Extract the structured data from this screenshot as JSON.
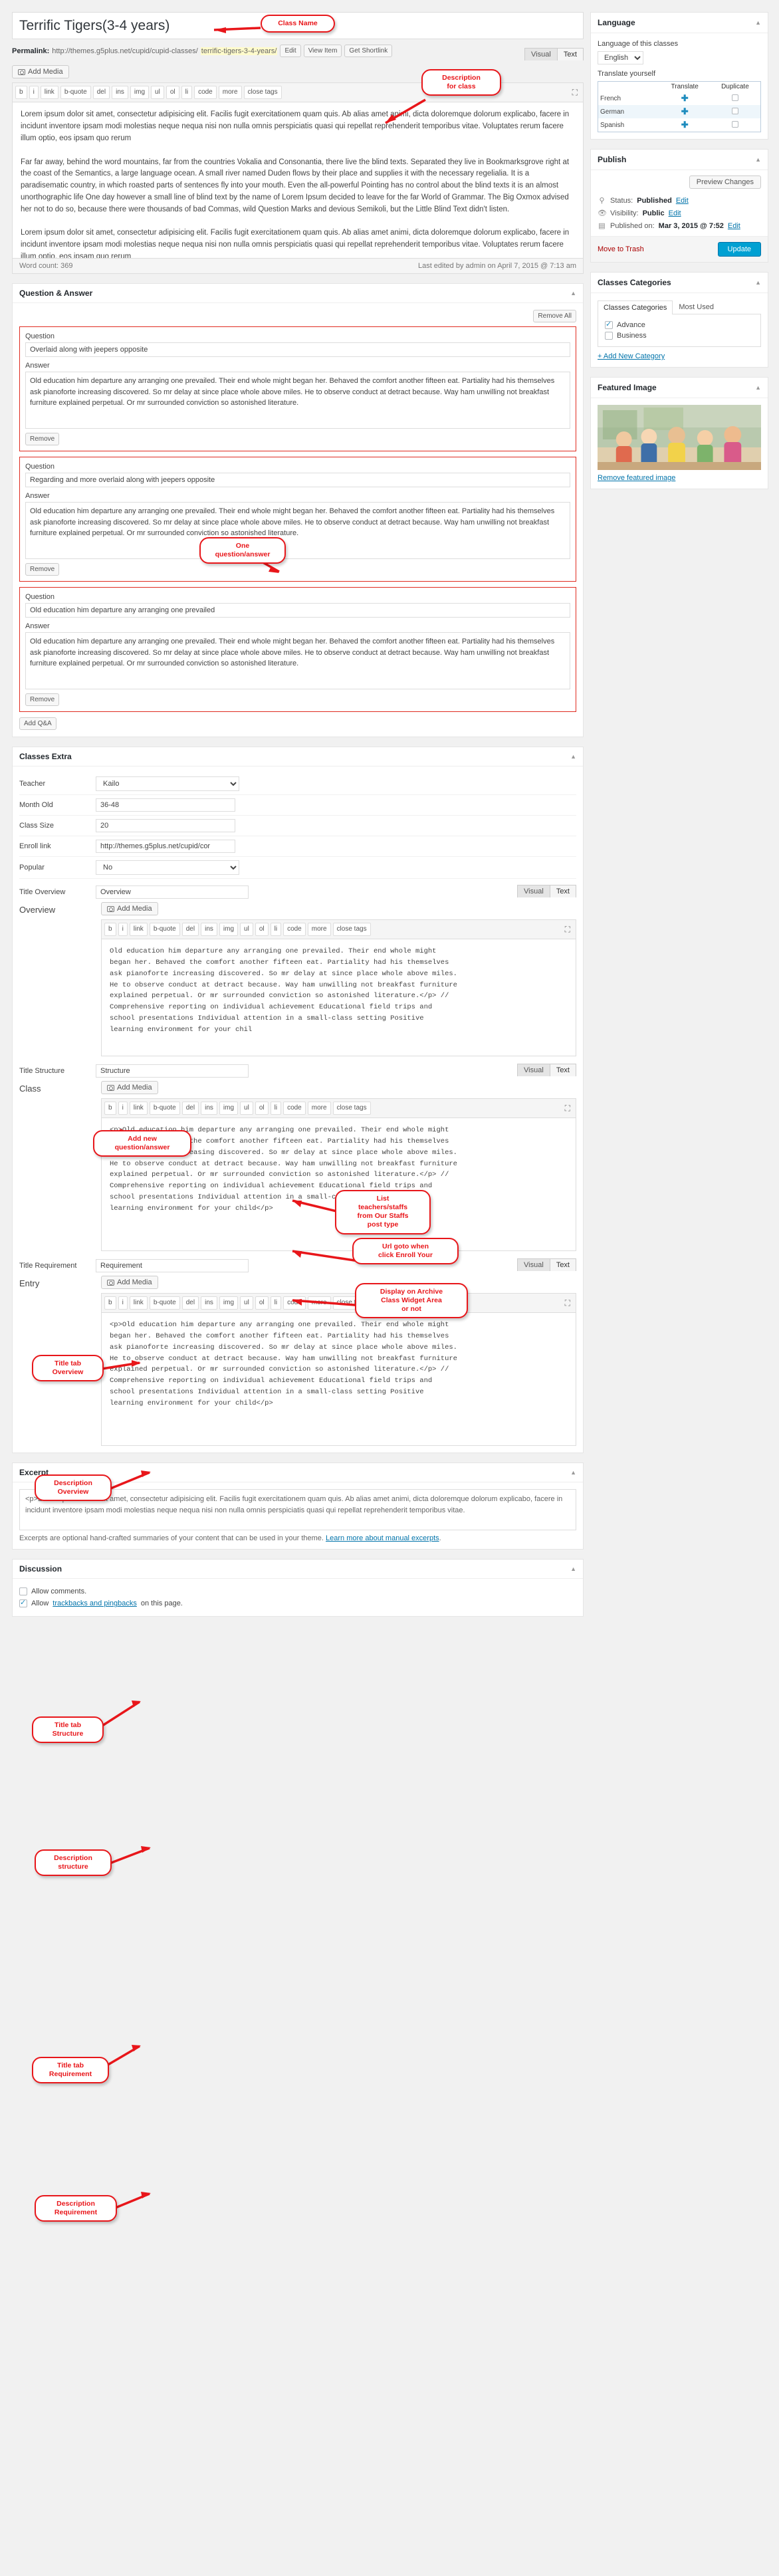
{
  "post": {
    "title": "Terrific Tigers(3-4 years)",
    "permalink_label": "Permalink:",
    "permalink_base": "http://themes.g5plus.net/cupid/cupid-classes/",
    "permalink_slug": "terrific-tigers-3-4-years/",
    "btn_edit": "Edit",
    "btn_view": "View Item",
    "btn_shortlink": "Get Shortlink"
  },
  "editor_main": {
    "add_media": "Add Media",
    "tab_visual": "Visual",
    "tab_text": "Text",
    "toolbar": [
      "b",
      "i",
      "link",
      "b-quote",
      "del",
      "ins",
      "img",
      "ul",
      "ol",
      "li",
      "code",
      "more",
      "close tags"
    ],
    "body": "Lorem ipsum dolor sit amet, consectetur adipisicing elit. Facilis fugit exercitationem quam quis. Ab alias amet animi, dicta doloremque dolorum explicabo, facere in incidunt inventore ipsam modi molestias neque nequa nisi non nulla omnis perspiciatis quasi qui repellat reprehenderit temporibus vitae. Voluptates rerum facere illum optio, eos ipsam quo rerum\n\nFar far away, behind the word mountains, far from the countries Vokalia and Consonantia, there live the blind texts. Separated they live in Bookmarksgrove right at the coast of the Semantics, a large language ocean. A small river named Duden flows by their place and supplies it with the necessary regelialia. It is a paradisematic country, in which roasted parts of sentences fly into your mouth. Even the all-powerful Pointing has no control about the blind texts it is an almost unorthographic life One day however a small line of blind text by the name of Lorem Ipsum decided to leave for the far World of Grammar. The Big Oxmox advised her not to do so, because there were thousands of bad Commas, wild Question Marks and devious Semikoli, but the Little Blind Text didn't listen.\n\nLorem ipsum dolor sit amet, consectetur adipisicing elit. Facilis fugit exercitationem quam quis. Ab alias amet animi, dicta doloremque dolorum explicabo, facere in incidunt inventore ipsam modi molestias neque nequa nisi non nulla omnis perspiciatis quasi qui repellat reprehenderit temporibus vitae. Voluptates rerum facere illum optio, eos ipsam quo rerum\n\nFar far away, behind the word mountains, far from the countries Vokalia and Consonantia, there live the blind texts. Separated they live in Bookmarksgrove right at the coast of the Semantics, a large language ocean. A small river named Duden flows by their place and supplies it with the necessary regelialia. It is a paradisematic country, in which roasted parts of sentences fly into your mouth. Even the all-powerful Pointing has no control about the blind texts it is an almost unorthographic life One day however a small line of blind text by the name of Lorem Ipsum decided to leave for the far World of Grammar. The Big Oxmox advised her not to do so, because there were thousands of bad Commas, wild Question Marks and devious Semikoli, but the Little Blind Text didn't listen.",
    "word_count": "Word count: 369",
    "last_edited": "Last edited by admin on April 7, 2015 @ 7:13 am"
  },
  "qa": {
    "panel_title": "Question & Answer",
    "remove_all": "Remove All",
    "label_question": "Question",
    "label_answer": "Answer",
    "remove": "Remove",
    "add_button": "Add Q&A",
    "items": [
      {
        "question": "Overlaid along with jeepers opposite",
        "answer": "Old education him departure any arranging one prevailed. Their end whole might began her. Behaved the comfort another fifteen eat. Partiality had his themselves ask pianoforte increasing discovered. So mr delay at since place whole above miles. He to observe conduct at detract because. Way ham unwilling not breakfast furniture explained perpetual. Or mr surrounded conviction so astonished literature."
      },
      {
        "question": "Regarding and more overlaid along with jeepers opposite",
        "answer": "Old education him departure any arranging one prevailed. Their end whole might began her. Behaved the comfort another fifteen eat. Partiality had his themselves ask pianoforte increasing discovered. So mr delay at since place whole above miles. He to observe conduct at detract because. Way ham unwilling not breakfast furniture explained perpetual. Or mr surrounded conviction so astonished literature."
      },
      {
        "question": "Old education him departure any arranging one prevailed",
        "answer": "Old education him departure any arranging one prevailed. Their end whole might began her. Behaved the comfort another fifteen eat. Partiality had his themselves ask pianoforte increasing discovered. So mr delay at since place whole above miles. He to observe conduct at detract because. Way ham unwilling not breakfast furniture explained perpetual. Or mr surrounded conviction so astonished literature."
      }
    ]
  },
  "classes_extra": {
    "panel_title": "Classes Extra",
    "fields": [
      {
        "label": "Teacher",
        "value": "Kailo",
        "type": "select"
      },
      {
        "label": "Month Old",
        "value": "36-48",
        "type": "text"
      },
      {
        "label": "Class Size",
        "value": "20",
        "type": "text"
      },
      {
        "label": "Enroll link",
        "value": "http://themes.g5plus.net/cupid/cor",
        "type": "text"
      },
      {
        "label": "Popular",
        "value": "No",
        "type": "select"
      }
    ],
    "tabs": [
      {
        "title_label": "Title Overview",
        "title_value": "Overview",
        "desc_label": "Overview",
        "add_media": "Add Media",
        "tab_visual": "Visual",
        "tab_text": "Text",
        "content": "Old education him departure any arranging one prevailed. Their end whole might\nbegan her. Behaved the comfort another fifteen eat. Partiality had his themselves\nask pianoforte increasing discovered. So mr delay at since place whole above miles.\nHe to observe conduct at detract because. Way ham unwilling not breakfast furniture\nexplained perpetual. Or mr surrounded conviction so astonished literature.</p> //\nComprehensive reporting on individual achievement Educational field trips and\nschool presentations Individual attention in a small-class setting Positive\nlearning environment for your chil"
      },
      {
        "title_label": "Title Structure",
        "title_value": "Structure",
        "desc_label": "Class",
        "add_media": "Add Media",
        "tab_visual": "Visual",
        "tab_text": "Text",
        "content": "<p>Old education him departure any arranging one prevailed. Their end whole might\nbegan her. Behaved the comfort another fifteen eat. Partiality had his themselves\nask pianoforte increasing discovered. So mr delay at since place whole above miles.\nHe to observe conduct at detract because. Way ham unwilling not breakfast furniture\nexplained perpetual. Or mr surrounded conviction so astonished literature.</p> //\nComprehensive reporting on individual achievement Educational field trips and\nschool presentations Individual attention in a small-class setting Positive\nlearning environment for your child</p>"
      },
      {
        "title_label": "Title Requirement",
        "title_value": "Requirement",
        "desc_label": "Entry",
        "add_media": "Add Media",
        "tab_visual": "Visual",
        "tab_text": "Text",
        "content": "<p>Old education him departure any arranging one prevailed. Their end whole might\nbegan her. Behaved the comfort another fifteen eat. Partiality had his themselves\nask pianoforte increasing discovered. So mr delay at since place whole above miles.\nHe to observe conduct at detract because. Way ham unwilling not breakfast furniture\nexplained perpetual. Or mr surrounded conviction so astonished literature.</p> //\nComprehensive reporting on individual achievement Educational field trips and\nschool presentations Individual attention in a small-class setting Positive\nlearning environment for your child</p>"
      }
    ]
  },
  "excerpt": {
    "panel_title": "Excerpt",
    "value": "<p>Lorem ipsum dolor sit amet, consectetur adipisicing elit. Facilis fugit exercitationem quam quis. Ab alias amet animi, dicta doloremque dolorum explicabo, facere in incidunt inventore ipsam modi molestias neque nequa nisi non nulla omnis perspiciatis quasi qui repellat reprehenderit temporibus vitae.",
    "note_before": "Excerpts are optional hand-crafted summaries of your content that can be used in your theme. ",
    "note_link": "Learn more about manual excerpts"
  },
  "discussion": {
    "panel_title": "Discussion",
    "allow_comments": "Allow comments.",
    "allow_pings_before": "Allow ",
    "allow_pings_link": "trackbacks and pingbacks",
    "allow_pings_after": " on this page."
  },
  "sidebar": {
    "language": {
      "title": "Language",
      "label_of": "Language of this classes",
      "selected": "English",
      "translate_yourself": "Translate yourself",
      "col_translate": "Translate",
      "col_duplicate": "Duplicate",
      "rows": [
        "French",
        "German",
        "Spanish"
      ]
    },
    "publish": {
      "title": "Publish",
      "preview": "Preview Changes",
      "status_label": "Status:",
      "status_value": "Published",
      "visibility_label": "Visibility:",
      "visibility_value": "Public",
      "published_label": "Published on:",
      "published_value": "Mar 3, 2015 @ 7:52",
      "edit": "Edit",
      "trash": "Move to Trash",
      "update": "Update"
    },
    "categories": {
      "title": "Classes Categories",
      "tab_all": "Classes Categories",
      "tab_most": "Most Used",
      "items": [
        {
          "label": "Advance",
          "checked": true
        },
        {
          "label": "Business",
          "checked": false
        }
      ],
      "add_new": "+ Add New Category"
    },
    "featured": {
      "title": "Featured Image",
      "remove": "Remove featured image"
    }
  },
  "annotations": [
    {
      "id": "class-name",
      "text": "Class Name"
    },
    {
      "id": "desc-class",
      "text": "Description\nfor class"
    },
    {
      "id": "one-qa",
      "text": "One\nquestion/answer"
    },
    {
      "id": "add-qa",
      "text": "Add new\nquestion/answer"
    },
    {
      "id": "list-teachers",
      "text": "List\nteachers/staffs\nfrom Our Staffs\npost type"
    },
    {
      "id": "url-enroll",
      "text": "Url goto when\nclick Enroll Your"
    },
    {
      "id": "display-archive",
      "text": "Display on Archive\nClass Widget Area\nor not"
    },
    {
      "id": "title-overview",
      "text": "Title tab\nOverview"
    },
    {
      "id": "desc-overview",
      "text": "Description\nOverview"
    },
    {
      "id": "title-structure",
      "text": "Title tab\nStructure"
    },
    {
      "id": "desc-structure",
      "text": "Description\nstructure"
    },
    {
      "id": "title-req",
      "text": "Title tab\nRequirement"
    },
    {
      "id": "desc-req",
      "text": "Description\nRequirement"
    }
  ],
  "colors": {
    "accent": "#00a0d2",
    "annotation": "#e8161a",
    "link": "#0073aa"
  }
}
